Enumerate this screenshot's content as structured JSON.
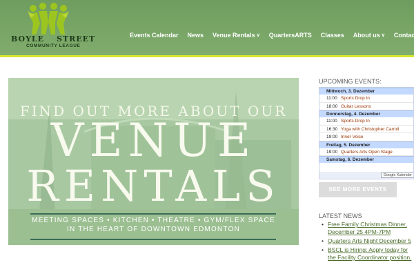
{
  "logo": {
    "word1": "BOYLE",
    "word2": "STREET",
    "tagline": "COMMUNITY LEAGUE"
  },
  "nav": [
    {
      "label": "Events Calendar",
      "dropdown": false
    },
    {
      "label": "News",
      "dropdown": false
    },
    {
      "label": "Venue Rentals",
      "dropdown": true
    },
    {
      "label": "QuartersARTS",
      "dropdown": false
    },
    {
      "label": "Classes",
      "dropdown": false
    },
    {
      "label": "About us",
      "dropdown": true
    },
    {
      "label": "Contact",
      "dropdown": false
    }
  ],
  "banner": {
    "line1": "FIND OUT MORE ABOUT OUR",
    "line2": "VENUE",
    "line3": "RENTALS",
    "sub1": "MEETING SPACES • KITCHEN • THEATRE • GYM/FLEX SPACE",
    "sub2": "IN THE HEART OF DOWNTOWN EDMONTON"
  },
  "sidebar": {
    "upcoming_heading": "UPCOMING EVENTS:",
    "calendar": [
      {
        "day": "Mittwoch, 3. Dezember",
        "events": [
          {
            "time": "11:00",
            "title": "Sports Drop In"
          },
          {
            "time": "18:00",
            "title": "Guitar Lessons"
          }
        ]
      },
      {
        "day": "Donnerstag, 4. Dezember",
        "events": [
          {
            "time": "11:00",
            "title": "Sports Drop In"
          },
          {
            "time": "16:30",
            "title": "Yoga with Christopher Carroll"
          },
          {
            "time": "19:00",
            "title": "Inner Voice"
          }
        ]
      },
      {
        "day": "Freitag, 5. Dezember",
        "events": [
          {
            "time": "19:00",
            "title": "Quarters Arts Open Stage"
          }
        ]
      },
      {
        "day": "Samstag, 6. Dezember",
        "events": []
      }
    ],
    "google_badge": "Google Kalender",
    "see_more": "SEE MORE EVENTS",
    "news_heading": "LATEST NEWS",
    "news": [
      "Free Family Christmas Dinner, December 25 4PM-7PM",
      "Quarters Arts Night December 5",
      "BSCL is Hiring: Apply today for the Facility Coordinator position."
    ]
  },
  "colors": {
    "header": "#7aa868",
    "accent_line": "#d8e62c",
    "link": "#4a6d2b",
    "event_title": "#993300"
  }
}
